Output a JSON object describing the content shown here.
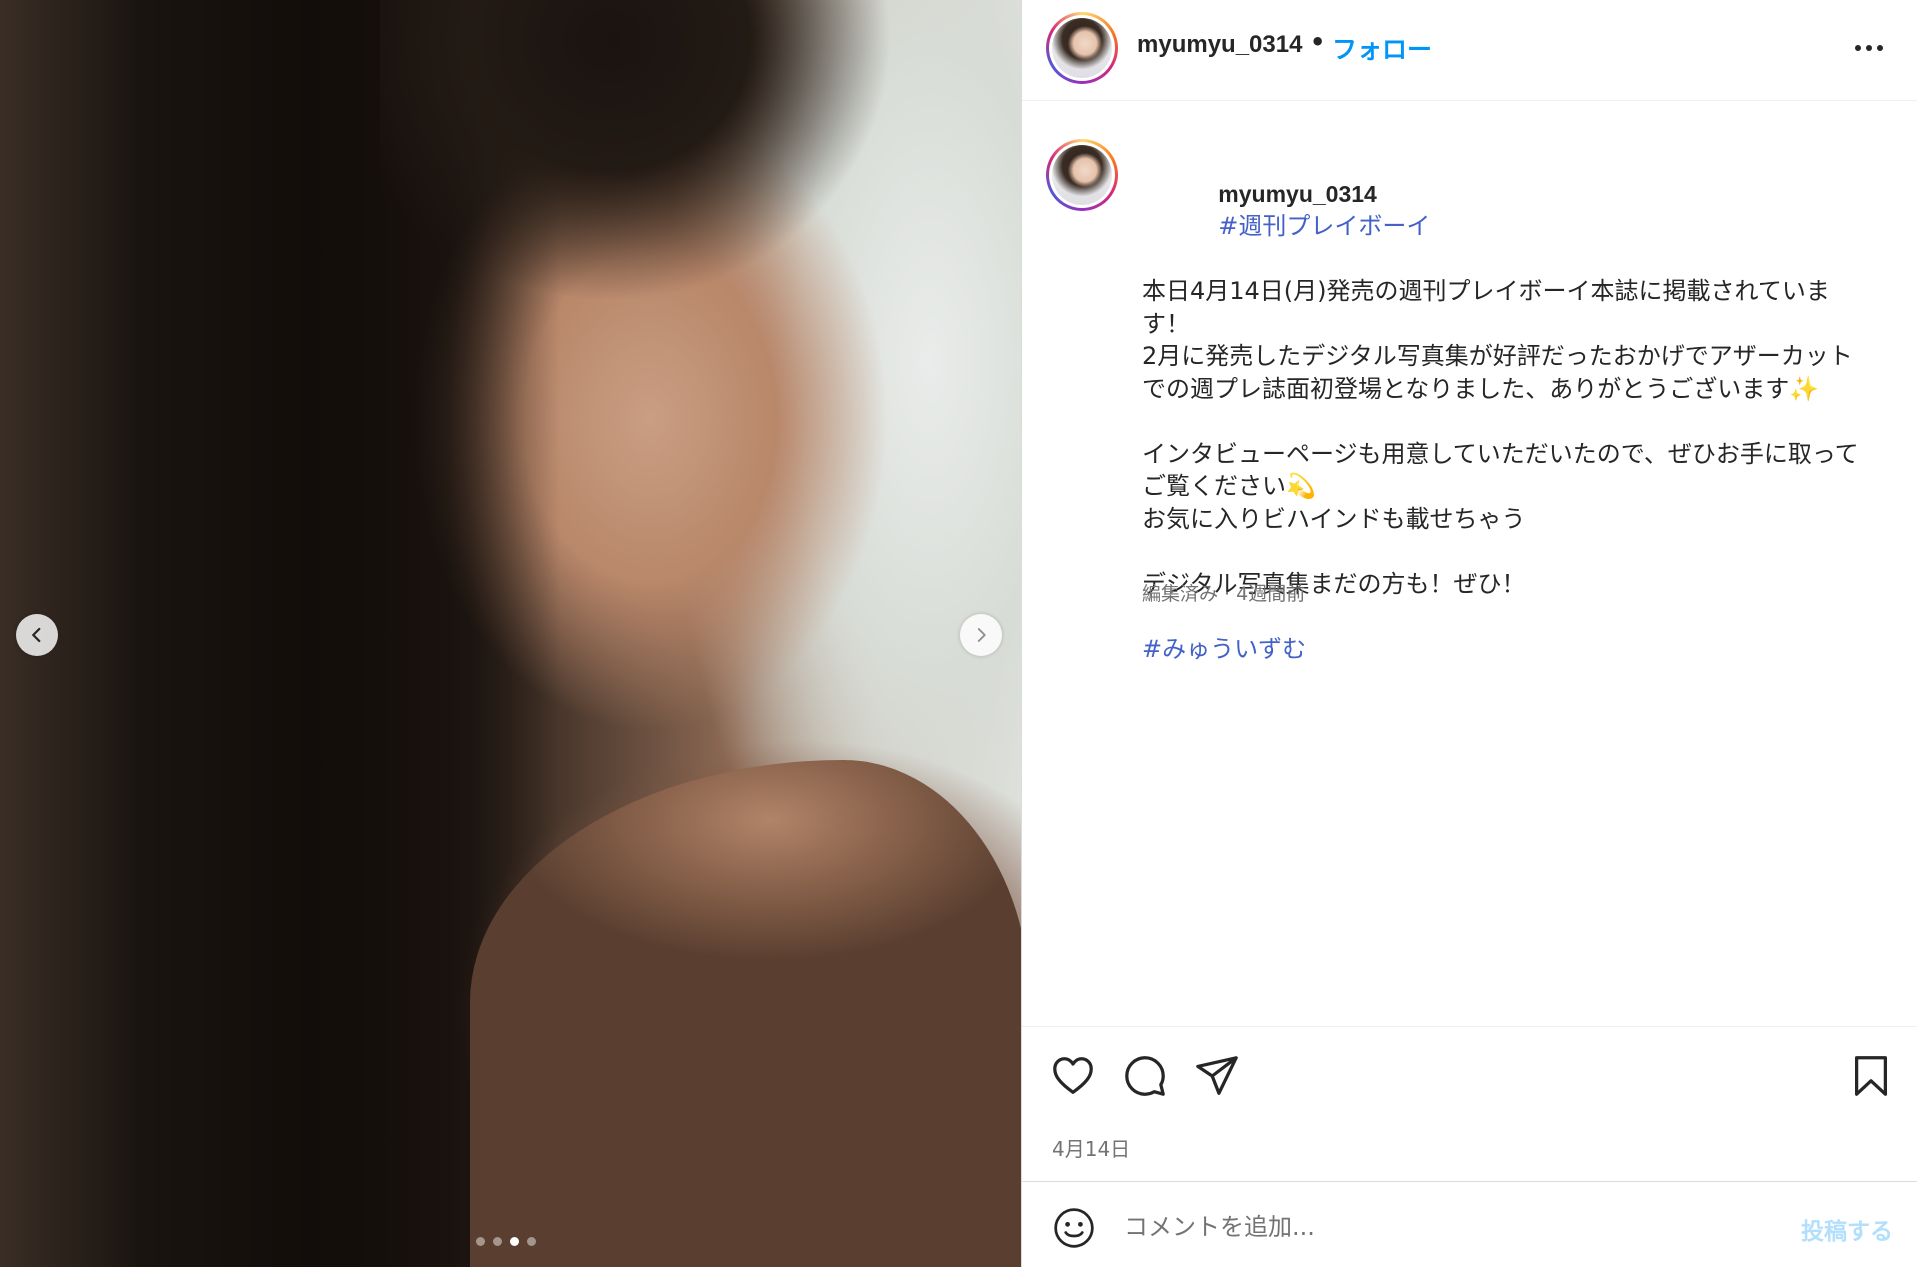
{
  "post": {
    "username": "myumyu_0314",
    "separator": "•",
    "follow_label": "フォロー",
    "carousel": {
      "total_slides": 4,
      "active_slide": 3
    }
  },
  "caption": {
    "username": "myumyu_0314",
    "lead_hashtag": "#週刊プレイボーイ",
    "lines": [
      "本日4月14日(月)発売の週刊プレイボーイ本誌に掲載されていま",
      "す！",
      "2月に発売したデジタル写真集が好評だったおかげでアザーカット",
      "での週プレ誌面初登場となりました、ありがとうございます✨",
      "",
      "インタビューページも用意していただいたので、ぜひお手に取って",
      "ご覧ください💫",
      "お気に入りビハインドも載せちゃう",
      "",
      "デジタル写真集まだの方も！ぜひ！",
      ""
    ],
    "trailing_hashtag": "#みゅういずむ",
    "meta": "編集済み · 4週間前"
  },
  "actions": {
    "date": "4月14日"
  },
  "comment": {
    "placeholder": "コメントを追加...",
    "post_label": "投稿する"
  },
  "colors": {
    "accent": "#0095f6",
    "hashtag": "#4361c7",
    "muted": "#737373",
    "post_disabled": "#b2dffc"
  },
  "icons": {
    "prev": "chevron-left-icon",
    "next": "chevron-right-icon",
    "more": "more-horizontal-icon",
    "like": "heart-icon",
    "comment": "comment-bubble-icon",
    "share": "paper-plane-icon",
    "save": "bookmark-icon",
    "emoji": "smiley-icon"
  }
}
